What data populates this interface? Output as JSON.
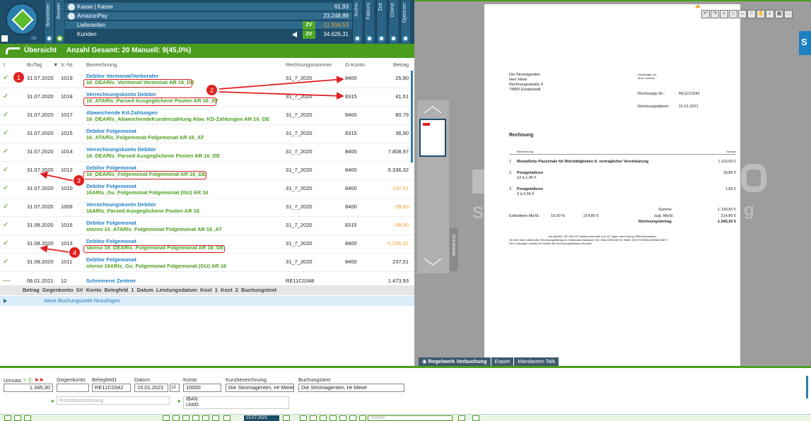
{
  "header": {
    "vtabs": [
      "Bearbeiten",
      "Berater",
      "Archiv",
      "Faktura",
      "Zeit",
      "Online",
      "Optionen"
    ],
    "accounts": [
      {
        "name": "Kasse | Kasse",
        "value": "61,93",
        "zv": "",
        "negative": false
      },
      {
        "name": "AmazonPay",
        "value": "23.248,89",
        "zv": "",
        "negative": false
      },
      {
        "name": "Lieferanten",
        "value": "-11.556,53",
        "zv": "ZV",
        "negative": true
      },
      {
        "name": "Kunden",
        "value": "34.626,31",
        "zv": "ZV",
        "negative": false
      }
    ]
  },
  "overview": {
    "title": "Übersicht",
    "summary": "Anzahl Gesamt: 20  Manuell: 9(45,0%)"
  },
  "table": {
    "columns": {
      "status": "I",
      "butag": "BuTag",
      "vnr": "V.-Nr.",
      "bezeichnung": "Bezeichnung",
      "rechnungsnummer": "Rechnungsnummer",
      "gkonto": "G-Konto",
      "betrag": "Betrag"
    },
    "rows": [
      {
        "date": "31.07.2020",
        "vnr": "1019",
        "l1": "Debitor Vormonat/Vorberater",
        "l2": "16_DEARls_Vormonat Vormonat AR 16_DE",
        "rn": "31_7_2020",
        "gk": "8400",
        "betrag": "25,90",
        "orange": false
      },
      {
        "date": "31.07.2020",
        "vnr": "1018",
        "l1": "Verrechnungskonto Debitor",
        "l2": "16_ATARls_Parsed Ausgeglichene Posten AR 16_AT",
        "rn": "31_7_2020",
        "gk": "8315",
        "betrag": "41,51",
        "orange": false
      },
      {
        "date": "31.07.2020",
        "vnr": "1017",
        "l1": "Abweichende Kd-Zahlungen",
        "l2": "16_DEARls_AbweichendeKundenzahlung Abw. KD-Zahlungen AR 16_DE",
        "rn": "31_7_2020",
        "gk": "8400",
        "betrag": "80,79",
        "orange": false
      },
      {
        "date": "31.07.2020",
        "vnr": "1015",
        "l1": "Debitor Folgemonat",
        "l2": "16_ATARls_Folgemonat Folgemonat AR 16_AT",
        "rn": "31_7_2020",
        "gk": "8315",
        "betrag": "36,90",
        "orange": false
      },
      {
        "date": "31.07.2020",
        "vnr": "1014",
        "l1": "Verrechnungskonto Debitor",
        "l2": "16_DEARls_Parsed Ausgeglichene Posten AR 16_DE",
        "rn": "31_7_2020",
        "gk": "8400",
        "betrag": "7.808,97",
        "orange": false
      },
      {
        "date": "31.07.2020",
        "vnr": "1012",
        "l1": "Debitor Folgemonat",
        "l2": "16_DEARls_Folgemonat Folgemonat AR 16_DE",
        "rn": "31_7_2020",
        "gk": "8400",
        "betrag": "5.336,32",
        "orange": false
      },
      {
        "date": "31.07.2020",
        "vnr": "1010",
        "l1": "Debitor Folgemonat",
        "l2": "16ARls_Gu_Folgemonat Folgemonat (GU) AR 16",
        "rn": "31_7_2020",
        "gk": "8400",
        "betrag": "-237,01",
        "orange": true
      },
      {
        "date": "31.07.2020",
        "vnr": "1009",
        "l1": "Verrechnungskonto Debitor",
        "l2": "16ARls_Parsed Ausgeglichene Posten AR 16",
        "rn": "31_7_2020",
        "gk": "8400",
        "betrag": "-39,80",
        "orange": true
      },
      {
        "date": "31.08.2020",
        "vnr": "1016",
        "l1": "Debitor Folgemonat",
        "l2": "storno 16_ATARls_Folgemonat Folgemonat AR 16_AT",
        "rn": "31_7_2020",
        "gk": "8315",
        "betrag": "-36,90",
        "orange": true
      },
      {
        "date": "31.08.2020",
        "vnr": "1013",
        "l1": "Debitor Folgemonat",
        "l2": "storno 16_DEARls_Folgemonat Folgemonat AR 16_DE",
        "rn": "31_7_2020",
        "gk": "8400",
        "betrag": "-5.336,32",
        "orange": true
      },
      {
        "date": "31.08.2020",
        "vnr": "1011",
        "l1": "Debitor Folgemonat",
        "l2": "storno 16ARls_Gu_Folgemonat Folgemonat (GU) AR 16",
        "rn": "31_7_2020",
        "gk": "8400",
        "betrag": "237,01",
        "orange": false
      },
      {
        "date": "06.01.2021",
        "vnr": "12",
        "l1": "Schreinerei Zentner",
        "l2": "",
        "rn": "RE11C0348",
        "gk": "",
        "betrag": "1.473,93",
        "orange": false
      }
    ],
    "subheader": "Betrag  Gegenkonto  SV  Konto  Belegfeld 1  Datum  Leistungsdatum  Kost 1  Kost 2  Buchungstext",
    "add_row": "Neue Buchungszeile hinzufügen"
  },
  "annotations": [
    "1",
    "2",
    "3",
    "4"
  ],
  "document": {
    "sender_name": "Die Stromagenten",
    "sender_contact": "Herr Meier",
    "sender_street": "Rechnungsstraße 9",
    "sender_city": "74865 Ersatzstadt",
    "return_label": "Rückfragen an:",
    "return_value": "Moro Zentner",
    "rn_label": "Rechnungs-Nr.:",
    "rn_value": "RE11C0342",
    "rd_label": "Rechnungsdatum:",
    "rd_value": "15.01.2021",
    "heading": "Rechnung",
    "col_desc": "Bezeichnung",
    "col_sum": "Summe",
    "items": [
      {
        "n": "1",
        "title": "Monatliche Pauschale für Bürotätigkeiten lt. vertraglicher Vereinbarung",
        "sub": "",
        "amount": "1.110,00 €"
      },
      {
        "n": "2",
        "title": "Postgebühren",
        "sub": "13 à 1,45 €",
        "amount": "18,85 €"
      },
      {
        "n": "3",
        "title": "Postgebühren",
        "sub": "3 à 0,55 €",
        "amount": "1,65 €"
      }
    ],
    "sum_label": "Summe",
    "sum_value": "1.130,50 €",
    "vat_label": "Enthaltene MwSt.:",
    "vat_rate": "19,00 %",
    "vat_base": "214,80 €",
    "vat_plus_label": "zzgl. MwSt.",
    "vat_plus_value": "214,80 €",
    "total_label": "Rechnungsbetrag",
    "total_value": "1.345,30 €",
    "footer1": "Ust-IdentNr. DE 361175     Zahlbar innerhalb von 10 Tagen ohne Abzug. Bitte überweisen",
    "footer2": "Sie den oben stehenden Rechnungsbetrag an: Volksbank Baustadt, BIC: MALADE51MYN, IBAN: DE27576500100098224870",
    "footer3": "Die Leistungen wurden im Monat der Rechnungsstellung erbracht."
  },
  "right": {
    "doc_label": "Dokumente",
    "toolbar_icons": [
      "undo-icon",
      "redo-icon",
      "zoom-in-icon",
      "circle-icon",
      "fit-width-icon",
      "zoom-out-icon",
      "hand-icon",
      "search-icon",
      "grid-icon",
      "fullscreen-icon"
    ],
    "tabs": [
      "Regelwerk Verbuchung",
      "Export",
      "Mandanten Talk"
    ],
    "side_letter": "S"
  },
  "form": {
    "umsatz_label": "Umsatz",
    "umsatz_value": "1.345,30",
    "gegenkonto_label": "Gegenkonto",
    "gegenkonto_value": "",
    "belegfeld1_label": "Belegfeld1",
    "belegfeld1_value": "RE11C0342",
    "datum_label": "Datum",
    "datum_value": "15.01.2021",
    "datum_day": "15",
    "konto_label": "Konto",
    "konto_value": "10000",
    "kurz_label": "Kurzbezeichnung",
    "kurz_value": "Die Stromagenten, Hr Meier",
    "buchung_label": "Buchungstext",
    "buchung_value": "Die Stromagenten, Hr Meier",
    "kontobez_placeholder": "Kontobezeichnung",
    "iban_label": "IBAN:",
    "ustid_label": "UstID:"
  },
  "bottombar": {
    "date": "15.07.2021",
    "search_placeholder": "Suchen"
  },
  "colors": {
    "primary": "#1e4d69",
    "green": "#4b9d1e",
    "link": "#1e7fc2",
    "warning": "#f0a030",
    "annotation": "#e02020"
  }
}
